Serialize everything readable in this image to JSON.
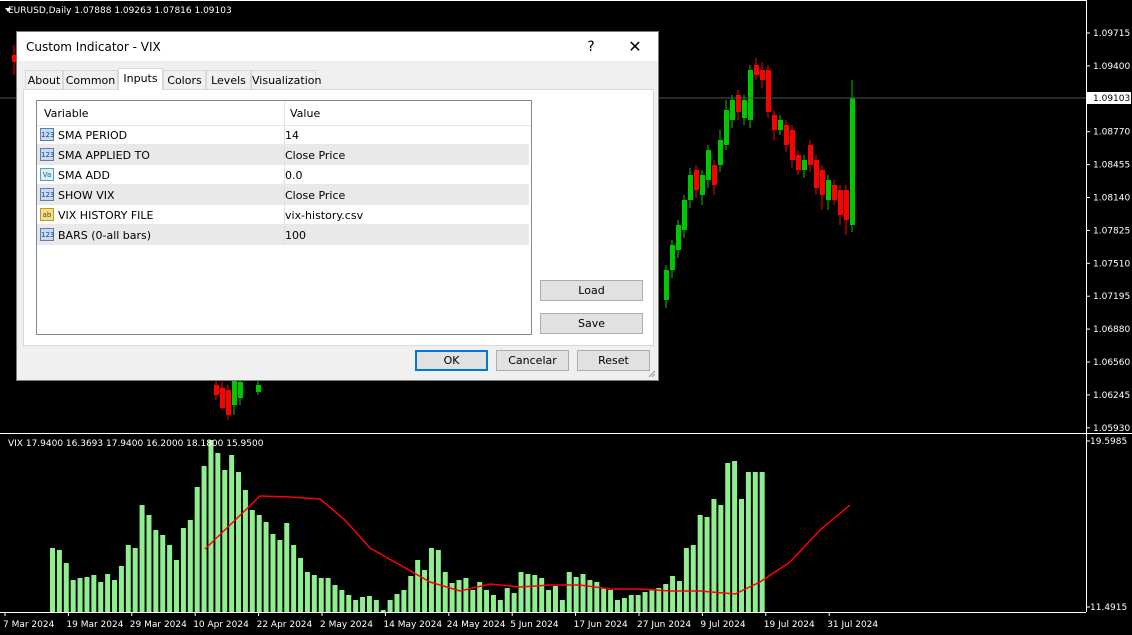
{
  "chart": {
    "main_header": "EURUSD,Daily  1.07888 1.09263 1.07816 1.09103",
    "price_ticks": [
      "1.09715",
      "1.09400",
      "1.09103",
      "1.08770",
      "1.08455",
      "1.08140",
      "1.07825",
      "1.07510",
      "1.07195",
      "1.06880",
      "1.06560",
      "1.06245",
      "1.05930"
    ],
    "current_price": "1.09103",
    "indicator_header": "VIX 17.9400 16.3693 17.9400 16.2000 18.1800 15.9500",
    "indicator_ticks": [
      "19.5985",
      "11.4915"
    ],
    "date_ticks": [
      "7 Mar 2024",
      "19 Mar 2024",
      "29 Mar 2024",
      "10 Apr 2024",
      "22 Apr 2024",
      "2 May 2024",
      "14 May 2024",
      "24 May 2024",
      "5 Jun 2024",
      "17 Jun 2024",
      "27 Jun 2024",
      "9 Jul 2024",
      "19 Jul 2024",
      "31 Jul 2024"
    ],
    "colors": {
      "bull": "#00c800",
      "bear": "#ff0000",
      "histogram": "#90ee90",
      "sma_line": "#ff0000",
      "grid_text": "#ffffff"
    }
  },
  "dialog": {
    "title": "Custom Indicator - VIX",
    "help_glyph": "?",
    "close_glyph": "✕",
    "tabs": [
      "About",
      "Common",
      "Inputs",
      "Colors",
      "Levels",
      "Visualization"
    ],
    "active_tab": "Inputs",
    "grid": {
      "headers": {
        "variable": "Variable",
        "value": "Value"
      },
      "rows": [
        {
          "icon": "123",
          "variable": "SMA PERIOD",
          "value": "14"
        },
        {
          "icon": "123",
          "variable": "SMA APPLIED TO",
          "value": "Close Price"
        },
        {
          "icon": "Va",
          "variable": "SMA ADD",
          "value": "0.0"
        },
        {
          "icon": "123",
          "variable": "SHOW VIX",
          "value": "Close Price"
        },
        {
          "icon": "ab",
          "variable": "VIX HISTORY FILE",
          "value": "vix-history.csv"
        },
        {
          "icon": "123",
          "variable": "BARS (0-all bars)",
          "value": "100"
        }
      ]
    },
    "buttons": {
      "load": "Load",
      "save": "Save",
      "ok": "OK",
      "cancel": "Cancelar",
      "reset": "Reset"
    }
  }
}
